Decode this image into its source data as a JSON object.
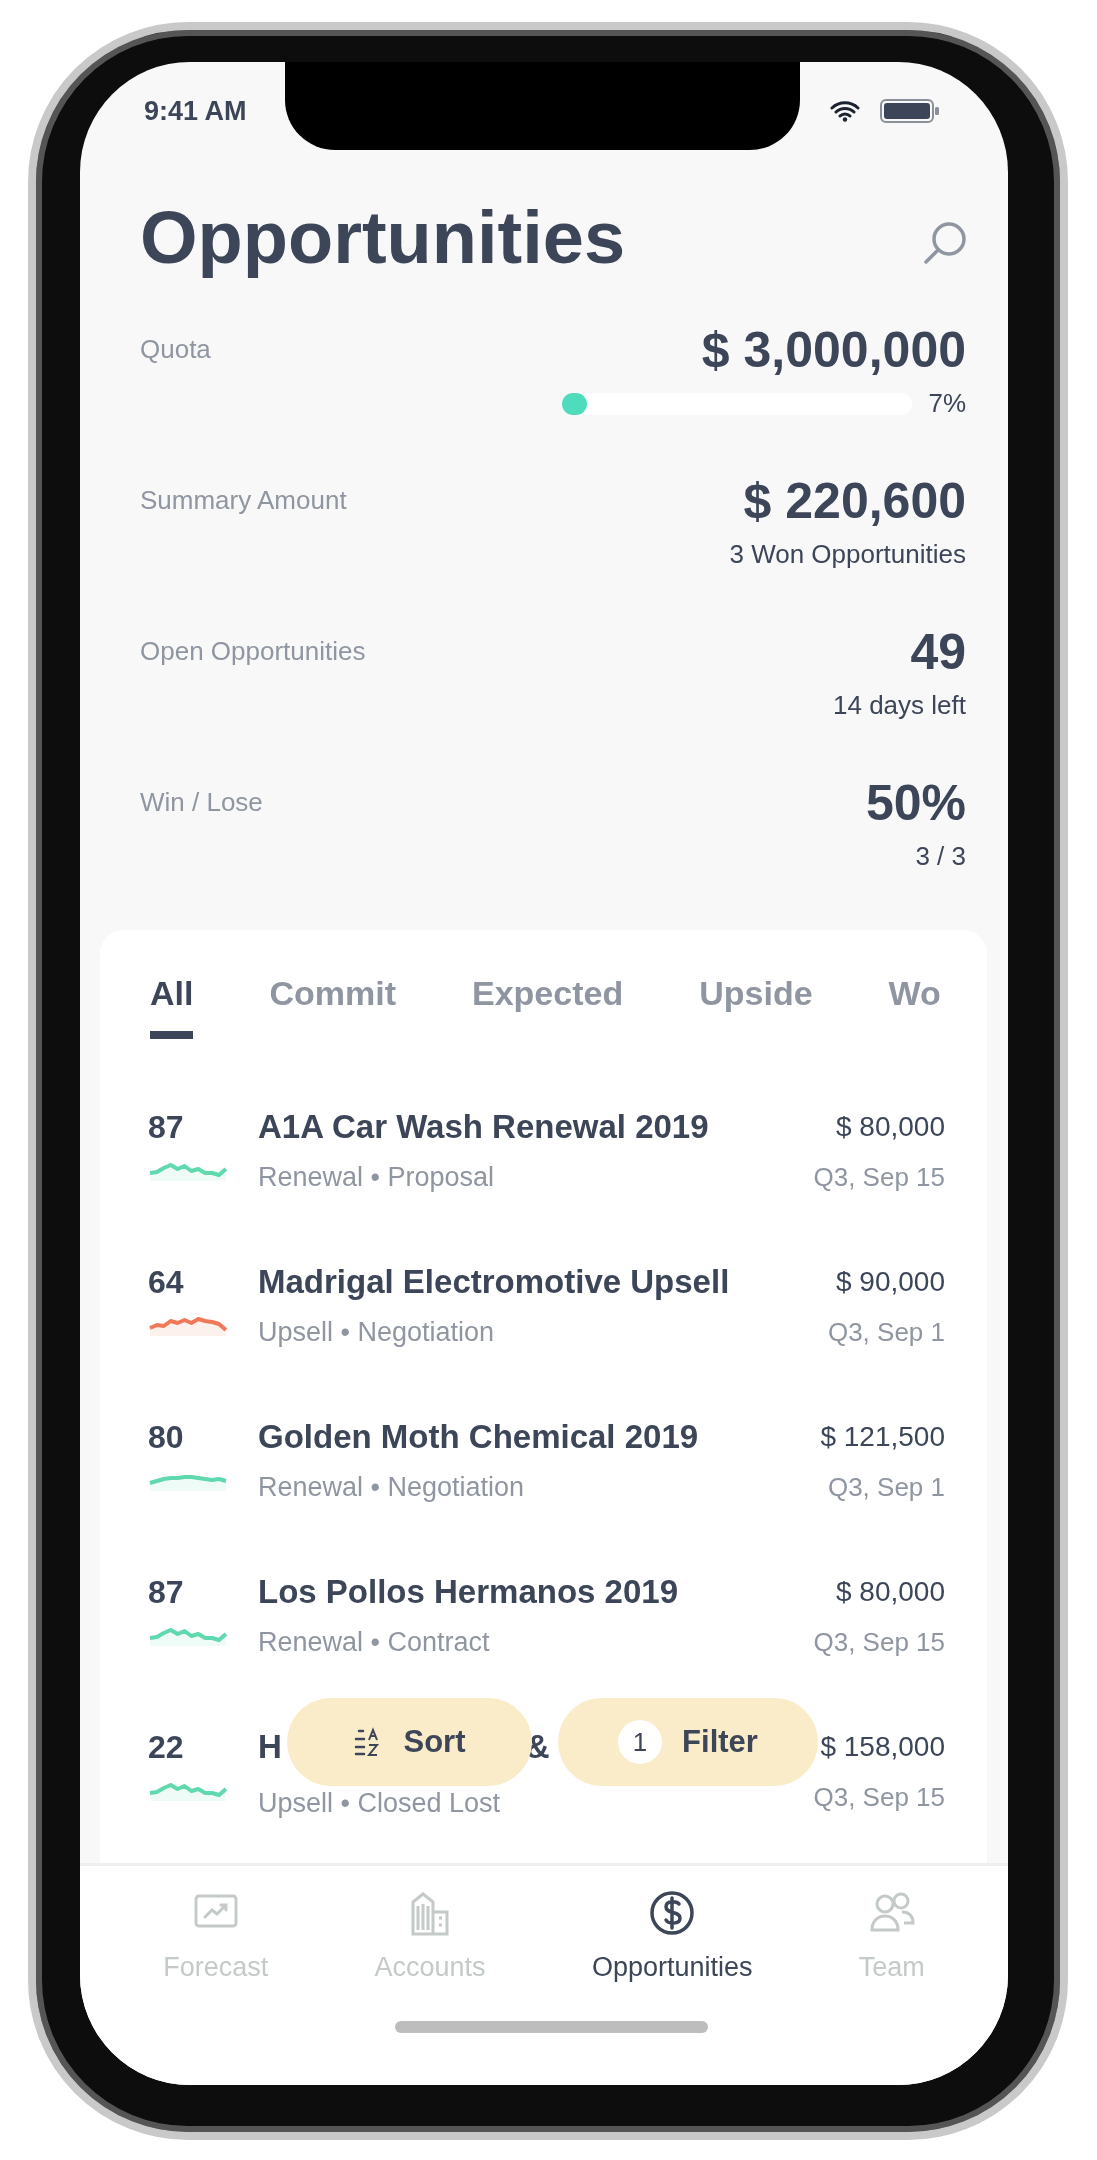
{
  "status_bar": {
    "time": "9:41 AM"
  },
  "header": {
    "title": "Opportunities"
  },
  "stats": [
    {
      "label": "Quota",
      "value": "$ 3,000,000",
      "kind": "progress",
      "level": 0.07,
      "reading": "7%"
    },
    {
      "label": "Summary Amount",
      "value": "$ 220,600",
      "kind": "text",
      "detail": "3 Won Opportunities"
    },
    {
      "label": "Open Opportunities",
      "value": "49",
      "kind": "text",
      "detail": "14 days left"
    },
    {
      "label": "Win / Lose",
      "value": "50%",
      "kind": "text",
      "detail": "3 / 3"
    }
  ],
  "tabs": [
    {
      "label": "All",
      "selected": true
    },
    {
      "label": "Commit",
      "selected": false
    },
    {
      "label": "Expected",
      "selected": false
    },
    {
      "label": "Upside",
      "selected": false
    },
    {
      "label": "Wo",
      "selected": false
    }
  ],
  "opportunities": [
    {
      "score": "87",
      "title": "A1A Car Wash Renewal 2019",
      "subtitle": "Renewal • Proposal",
      "amount": "$ 80,000",
      "date": "Q3, Sep 15",
      "color": "#5fd9ad"
    },
    {
      "score": "64",
      "title": "Madrigal Electromotive Upsell",
      "subtitle": "Upsell • Negotiation",
      "amount": "$ 90,000",
      "date": "Q3, Sep 1",
      "color": "#f0795a"
    },
    {
      "score": "80",
      "title": "Golden Moth Chemical 2019",
      "subtitle": "Renewal • Negotiation",
      "amount": "$ 121,500",
      "date": "Q3, Sep 1",
      "color": "#5fd9ad"
    },
    {
      "score": "87",
      "title": "Los Pollos Hermanos 2019",
      "subtitle": "Renewal • Contract",
      "amount": "$ 80,000",
      "date": "Q3, Sep 15",
      "color": "#5fd9ad"
    },
    {
      "score": "22",
      "title_fragments": [
        "H",
        "&"
      ],
      "subtitle": "Upsell • Closed Lost",
      "amount": "$ 158,000",
      "date": "Q3, Sep 15",
      "color": "#5fd9ad"
    }
  ],
  "actions": {
    "sort": {
      "label": "Sort"
    },
    "filter": {
      "label": "Filter",
      "count": "1"
    }
  },
  "tab_bar": [
    {
      "label": "Forecast",
      "kind": "chart",
      "selected": false
    },
    {
      "label": "Accounts",
      "kind": "building",
      "selected": false
    },
    {
      "label": "Opportunities",
      "kind": "dollar",
      "selected": true
    },
    {
      "label": "Team",
      "kind": "people",
      "selected": false
    }
  ]
}
